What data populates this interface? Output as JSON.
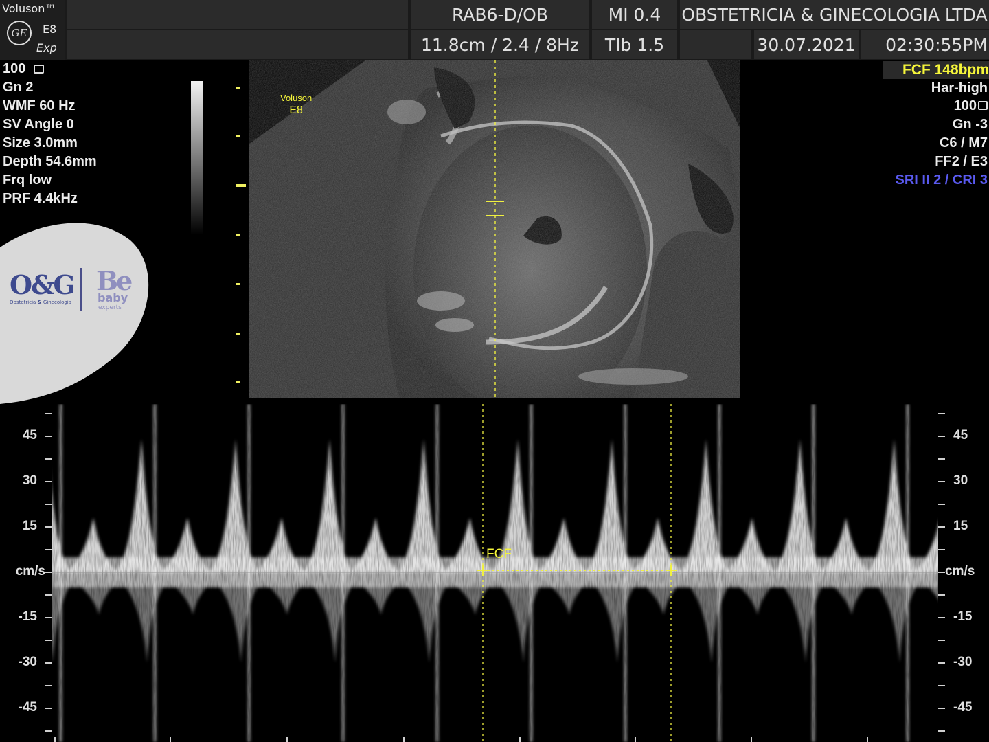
{
  "header": {
    "brand_name": "Voluson™",
    "brand_model": "E8",
    "brand_sub": "Exp",
    "ge_logo_text": "GE",
    "probe": "RAB6-D/OB",
    "mi": "MI  0.4",
    "clinic": "OBSTETRICIA & GINECOLOGIA LTDA",
    "depth_freq": "11.8cm / 2.4 /  8Hz",
    "tib": "TIb  1.5",
    "date": "30.07.2021",
    "time": "02:30:55PM"
  },
  "left_params": [
    "100",
    "Gn   2",
    "WMF 60 Hz",
    "SV Angle  0",
    "Size  3.0mm",
    "Depth 54.6mm",
    "Frq low",
    "PRF  4.4kHz"
  ],
  "right_params": {
    "fcf": "FCF 148bpm",
    "items": [
      "Har-high",
      "100",
      "Gn  -3",
      "C6 / M7",
      "FF2 / E3"
    ],
    "sri": "SRI II 2 / CRI 3"
  },
  "image_label": {
    "line1": "Voluson",
    "line2": "E8"
  },
  "watermark": {
    "logo_og": "O&G",
    "og_sub_1": "Obstetrícia",
    "og_sub_amp": "&",
    "og_sub_2": "Ginecologia",
    "be": "Be",
    "baby": "baby",
    "experts": "experts"
  },
  "doppler": {
    "unit": "cm/s",
    "ticks": [
      "45",
      "30",
      "15",
      "-15",
      "-30",
      "-45"
    ],
    "measure_label": "FCF",
    "heart_rate_bpm": 148
  },
  "colors": {
    "header_bg": "#2b2b2b",
    "annotation": "#f5f53a",
    "sri": "#5a5af0",
    "watermark_bg": "#d9d9d9"
  }
}
